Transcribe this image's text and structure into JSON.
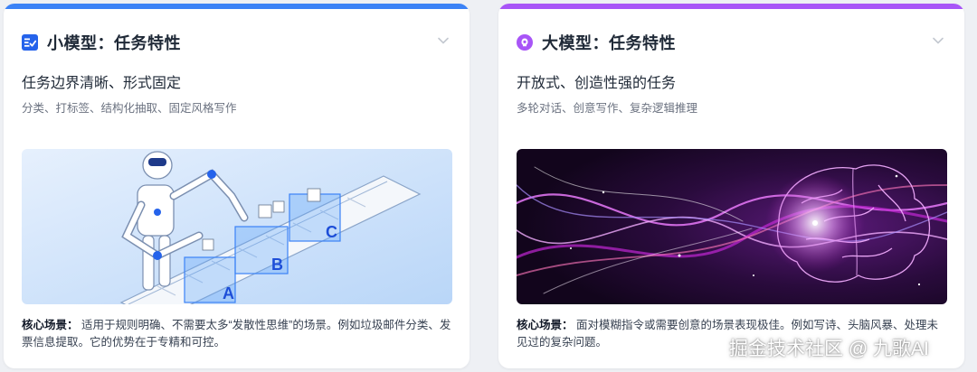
{
  "cards": [
    {
      "title": "小模型：任务特性",
      "icon": "checklist-icon",
      "accent": "#3b82f6",
      "subtitle": "任务边界清晰、形式固定",
      "tags": "分类、打标签、结构化抽取、固定风格写作",
      "illustration": "robot-sorting-boxes",
      "desc_lead": "核心场景：",
      "desc_text": "适用于规则明确、不需要太多“发散性思维”的场景。例如垃圾邮件分类、发票信息提取。它的优势在于专精和可控。",
      "box_letters": [
        "A",
        "B",
        "C"
      ]
    },
    {
      "title": "大模型：任务特性",
      "icon": "brain-icon",
      "accent": "#a855f7",
      "subtitle": "开放式、创造性强的任务",
      "tags": "多轮对话、创意写作、复杂逻辑推理",
      "illustration": "glowing-brain-waves",
      "desc_lead": "核心场景：",
      "desc_text": "面对模糊指令或需要创意的场景表现极佳。例如写诗、头脑风暴、处理未见过的复杂问题。"
    }
  ],
  "watermark": "掘金技术社区 @ 九歌AI"
}
